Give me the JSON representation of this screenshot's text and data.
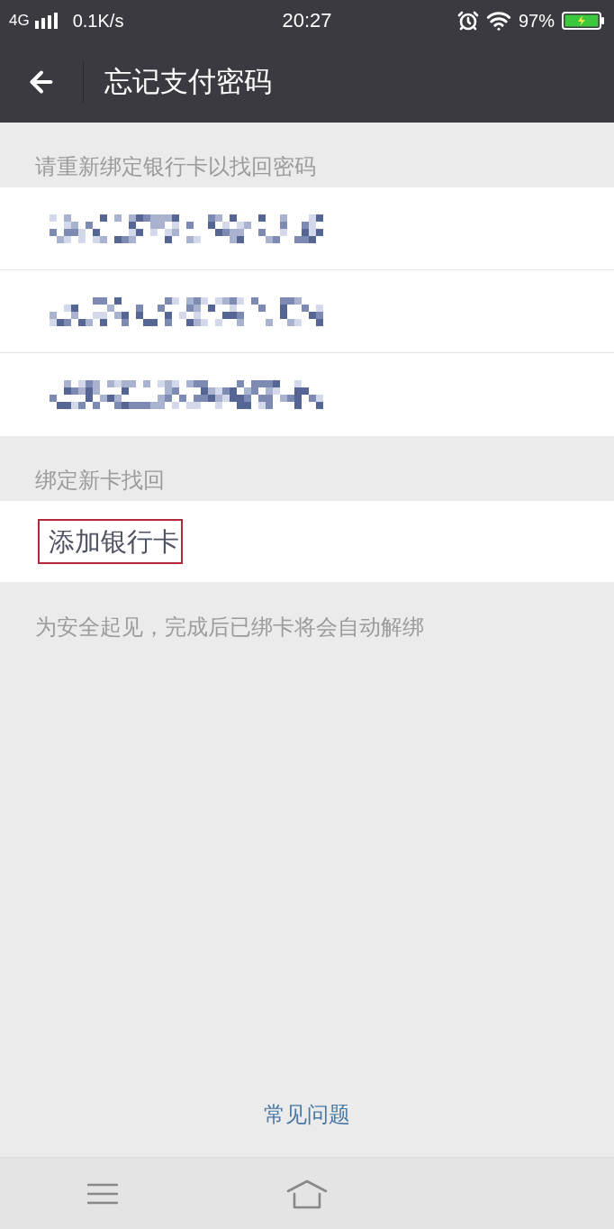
{
  "status_bar": {
    "network": "4G",
    "speed": "0.1K/s",
    "time": "20:27",
    "battery": "97%"
  },
  "header": {
    "title": "忘记支付密码"
  },
  "bound_cards": {
    "label": "请重新绑定银行卡以找回密码",
    "rows": [
      {
        "kind": "redacted"
      },
      {
        "kind": "redacted"
      },
      {
        "kind": "redacted"
      }
    ]
  },
  "new_card": {
    "label": "绑定新卡找回",
    "action": "添加银行卡",
    "highlighted": true
  },
  "note": "为安全起见，完成后已绑卡将会自动解绑",
  "faq_link": "常见问题",
  "nav_bar": {
    "buttons": [
      {
        "kind": "menu"
      },
      {
        "kind": "home"
      }
    ]
  }
}
